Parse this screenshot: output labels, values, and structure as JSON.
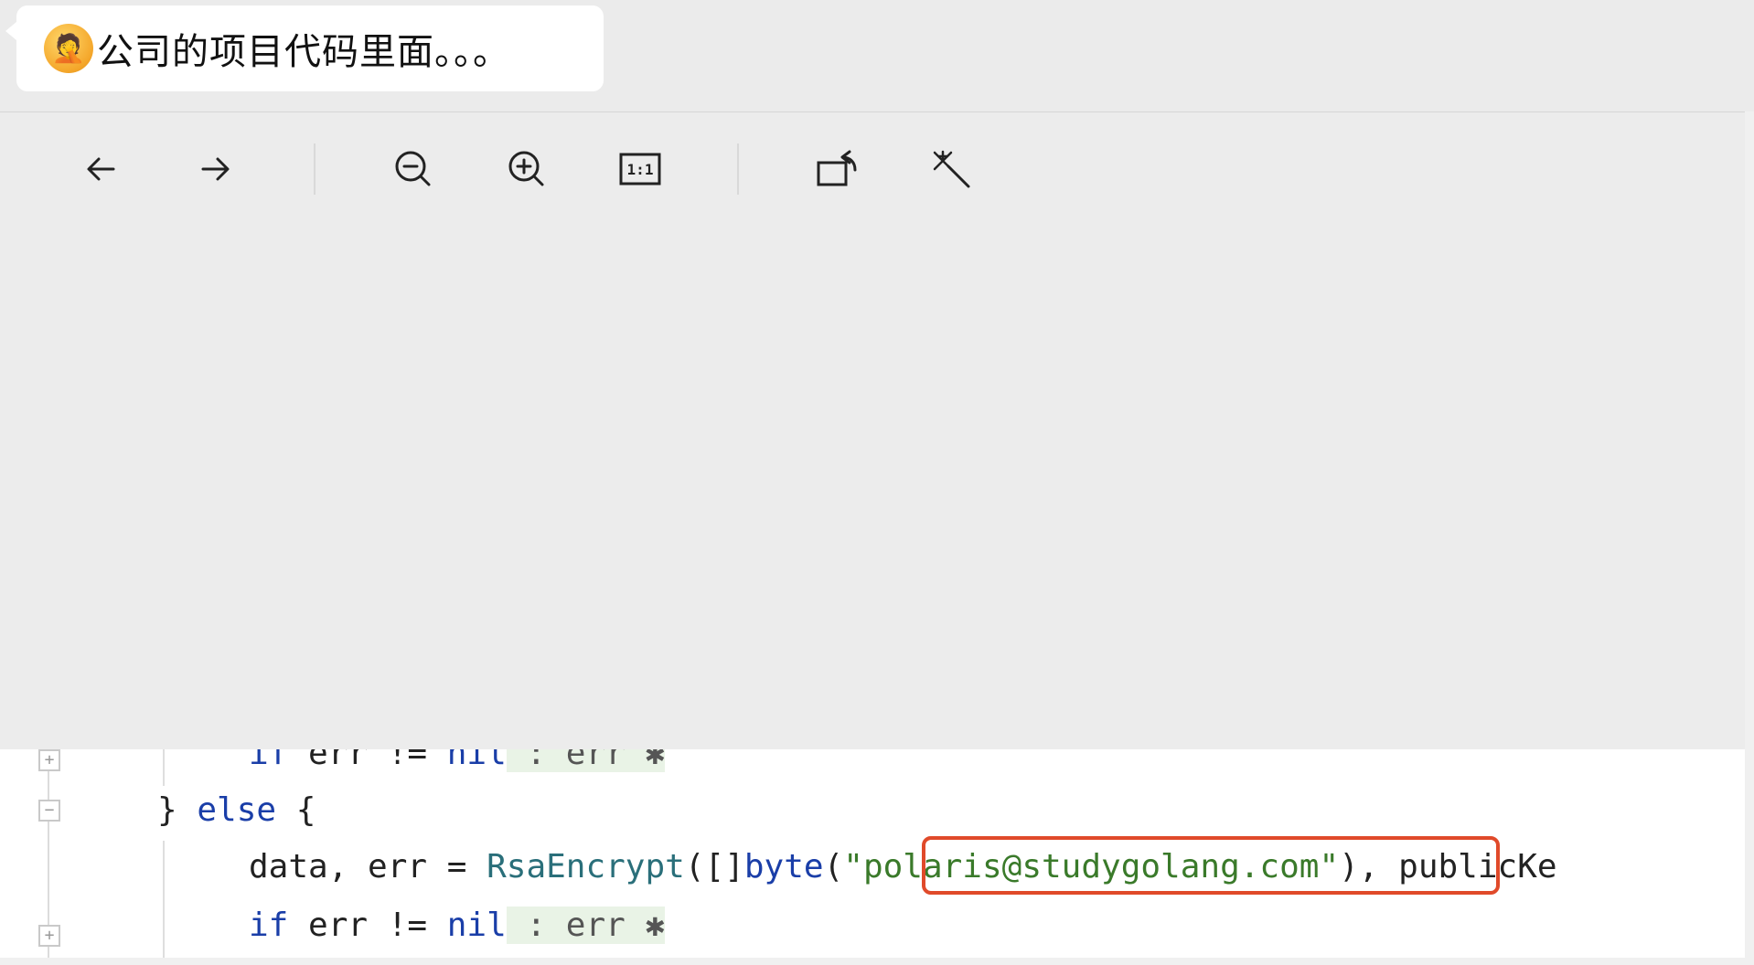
{
  "message": {
    "emoji": "🤦",
    "text": "公司的项目代码里面。。。"
  },
  "toolbar": {
    "back": "back-arrow-icon",
    "forward": "forward-arrow-icon",
    "zoom_out": "zoom-out-icon",
    "zoom_in": "zoom-in-icon",
    "actual_size": "1:1",
    "rotate": "rotate-icon",
    "enhance": "magic-wand-icon"
  },
  "code": {
    "line0": {
      "kw_if": "if",
      "rest": " err != ",
      "nil": "nil",
      "hint": " : err ✱"
    },
    "line1": {
      "brace": "} ",
      "kw_else": "else",
      "after": " {"
    },
    "line2": {
      "pre": "data, err = ",
      "fn": "RsaEncrypt",
      "mid": "([]",
      "kw_byte": "byte",
      "open": "(",
      "str": "\"polaris@studygolang.com\"",
      "post": "), publicKe"
    },
    "line3": {
      "kw_if": "if",
      "rest": " err != ",
      "nil": "nil",
      "hint": " : err ✱"
    }
  },
  "colors": {
    "keyword": "#1a3ea8",
    "string": "#3a7a2a",
    "highlight_box": "#e04a2a"
  }
}
